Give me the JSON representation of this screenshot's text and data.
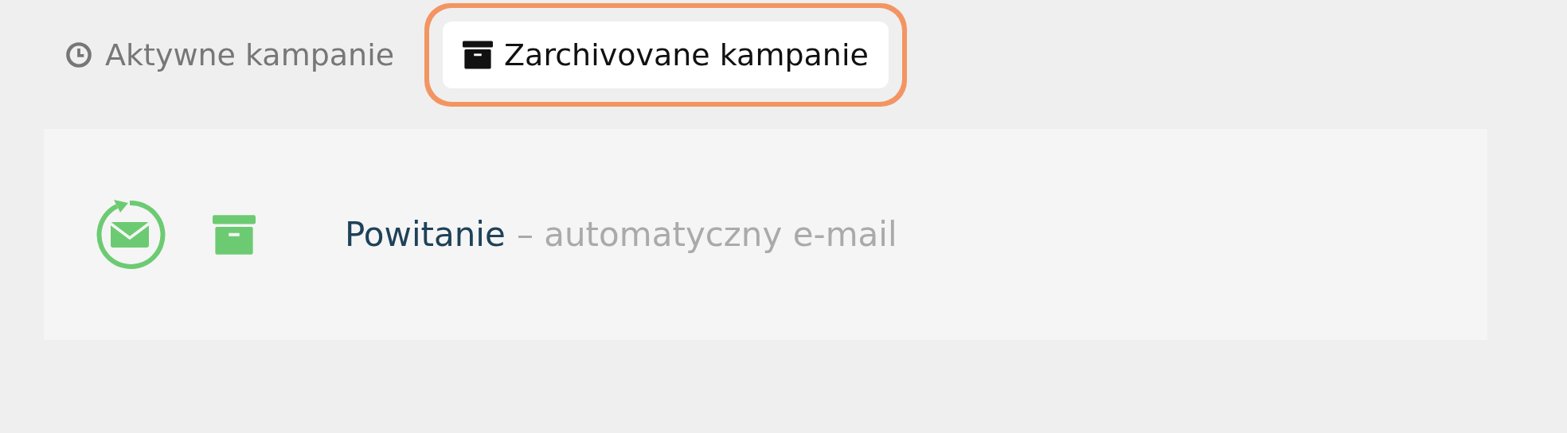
{
  "tabs": [
    {
      "label": "Aktywne kampanie",
      "kind": "clock",
      "selected": false
    },
    {
      "label": "Zarchivovane kampanie",
      "kind": "archive",
      "selected": true
    }
  ],
  "campaigns": [
    {
      "name": "Powitanie",
      "description": "– automatyczny e-mail"
    }
  ]
}
